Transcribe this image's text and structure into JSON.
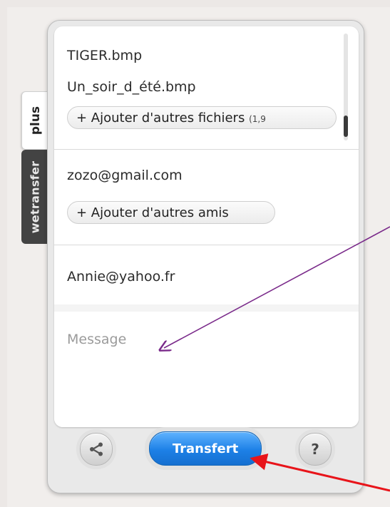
{
  "tabs": {
    "plus": "plus",
    "wetransfer": "wetransfer"
  },
  "files": {
    "items": [
      "TIGER.bmp",
      "Un_soir_d_été.bmp"
    ],
    "add_more_label": "+ Ajouter d'autres fichiers",
    "add_more_suffix": "(1,9"
  },
  "friends": {
    "email": "zozo@gmail.com",
    "add_more_label": "+ Ajouter d'autres amis"
  },
  "sender": {
    "email": "Annie@yahoo.fr"
  },
  "message": {
    "placeholder": "Message"
  },
  "buttons": {
    "share_icon": "share-icon",
    "transfer_label": "Transfert",
    "help_label": "?"
  },
  "annotations": {
    "arrow_colors": [
      "#7a2a8a",
      "#e8141a"
    ]
  }
}
